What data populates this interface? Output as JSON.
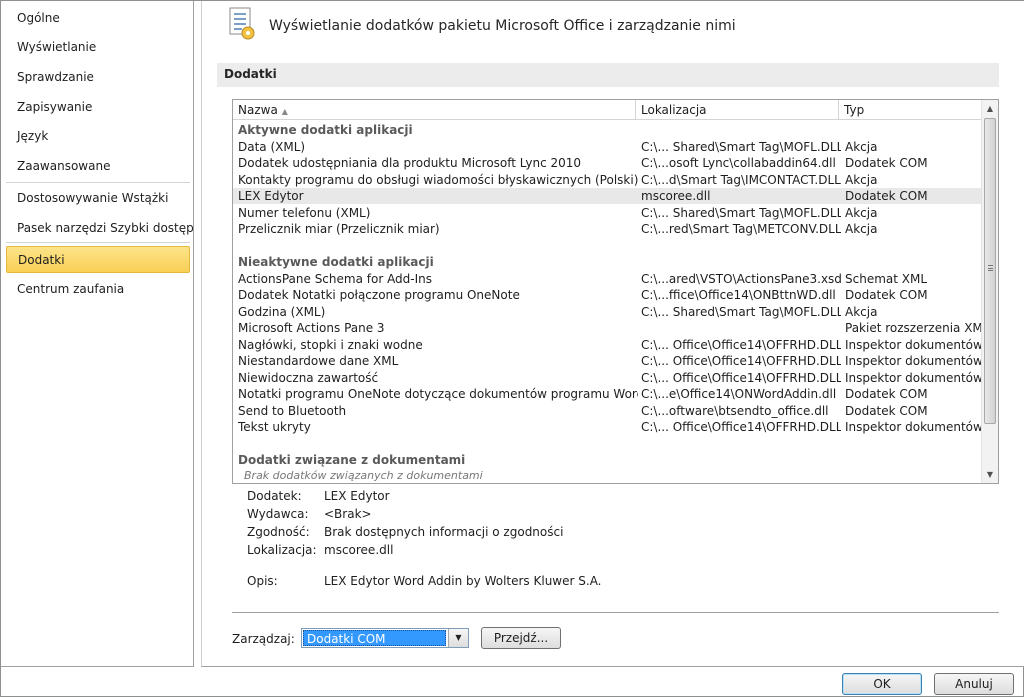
{
  "nav": {
    "items": [
      {
        "label": "Ogólne"
      },
      {
        "label": "Wyświetlanie"
      },
      {
        "label": "Sprawdzanie"
      },
      {
        "label": "Zapisywanie"
      },
      {
        "label": "Język"
      },
      {
        "label": "Zaawansowane"
      },
      {
        "label": "Dostosowywanie Wstążki"
      },
      {
        "label": "Pasek narzędzi Szybki dostęp"
      },
      {
        "label": "Dodatki",
        "selected": true
      },
      {
        "label": "Centrum zaufania"
      }
    ]
  },
  "header": {
    "icon": "addins-list-icon",
    "title": "Wyświetlanie dodatków pakietu Microsoft Office i zarządzanie nimi"
  },
  "section": {
    "title": "Dodatki"
  },
  "list": {
    "columns": {
      "name": "Nazwa",
      "location": "Lokalizacja",
      "type": "Typ"
    },
    "groups": {
      "active": {
        "title": "Aktywne dodatki aplikacji",
        "rows": [
          {
            "name": "Data (XML)",
            "location": "C:\\... Shared\\Smart Tag\\MOFL.DLL",
            "type": "Akcja"
          },
          {
            "name": "Dodatek udostępniania dla produktu Microsoft Lync 2010",
            "location": "C:\\...osoft Lync\\collabaddin64.dll",
            "type": "Dodatek COM"
          },
          {
            "name": "Kontakty programu do obsługi wiadomości błyskawicznych (Polski)",
            "location": "C:\\...d\\Smart Tag\\IMCONTACT.DLL",
            "type": "Akcja"
          },
          {
            "name": "LEX Edytor",
            "location": "mscoree.dll",
            "type": "Dodatek COM",
            "selected": true
          },
          {
            "name": "Numer telefonu (XML)",
            "location": "C:\\... Shared\\Smart Tag\\MOFL.DLL",
            "type": "Akcja"
          },
          {
            "name": "Przelicznik miar (Przelicznik miar)",
            "location": "C:\\...red\\Smart Tag\\METCONV.DLL",
            "type": "Akcja"
          }
        ]
      },
      "inactive": {
        "title": "Nieaktywne dodatki aplikacji",
        "rows": [
          {
            "name": "ActionsPane Schema for Add-Ins",
            "location": "C:\\...ared\\VSTO\\ActionsPane3.xsd",
            "type": "Schemat XML"
          },
          {
            "name": "Dodatek Notatki połączone programu OneNote",
            "location": "C:\\...ffice\\Office14\\ONBttnWD.dll",
            "type": "Dodatek COM"
          },
          {
            "name": "Godzina (XML)",
            "location": "C:\\... Shared\\Smart Tag\\MOFL.DLL",
            "type": "Akcja"
          },
          {
            "name": "Microsoft Actions Pane 3",
            "location": "",
            "type": "Pakiet rozszerzenia XML"
          },
          {
            "name": "Nagłówki, stopki i znaki wodne",
            "location": "C:\\... Office\\Office14\\OFFRHD.DLL",
            "type": "Inspektor dokumentów"
          },
          {
            "name": "Niestandardowe dane XML",
            "location": "C:\\... Office\\Office14\\OFFRHD.DLL",
            "type": "Inspektor dokumentów"
          },
          {
            "name": "Niewidoczna zawartość",
            "location": "C:\\... Office\\Office14\\OFFRHD.DLL",
            "type": "Inspektor dokumentów"
          },
          {
            "name": "Notatki programu OneNote dotyczące dokumentów programu Word",
            "location": "C:\\...e\\Office14\\ONWordAddin.dll",
            "type": "Dodatek COM"
          },
          {
            "name": "Send to Bluetooth",
            "location": "C:\\...oftware\\btsendto_office.dll",
            "type": "Dodatek COM"
          },
          {
            "name": "Tekst ukryty",
            "location": "C:\\... Office\\Office14\\OFFRHD.DLL",
            "type": "Inspektor dokumentów"
          }
        ]
      },
      "document": {
        "title": "Dodatki związane z dokumentami",
        "empty": "Brak dodatków związanych z dokumentami"
      }
    }
  },
  "details": {
    "addin_label": "Dodatek:",
    "addin_value": "LEX Edytor",
    "publisher_label": "Wydawca:",
    "publisher_value": "<Brak>",
    "compat_label": "Zgodność:",
    "compat_value": "Brak dostępnych informacji o zgodności",
    "location_label": "Lokalizacja:",
    "location_value": "mscoree.dll",
    "desc_label": "Opis:",
    "desc_value": "LEX Edytor Word Addin by Wolters Kluwer S.A."
  },
  "manage": {
    "label": "Zarządzaj:",
    "selected": "Dodatki COM",
    "go_button": "Przejdź..."
  },
  "footer": {
    "ok": "OK",
    "cancel": "Anuluj"
  },
  "colors": {
    "selection": "#fde48a",
    "list_selection": "#e8e8e8",
    "dropdown_highlight": "#3399ff"
  }
}
